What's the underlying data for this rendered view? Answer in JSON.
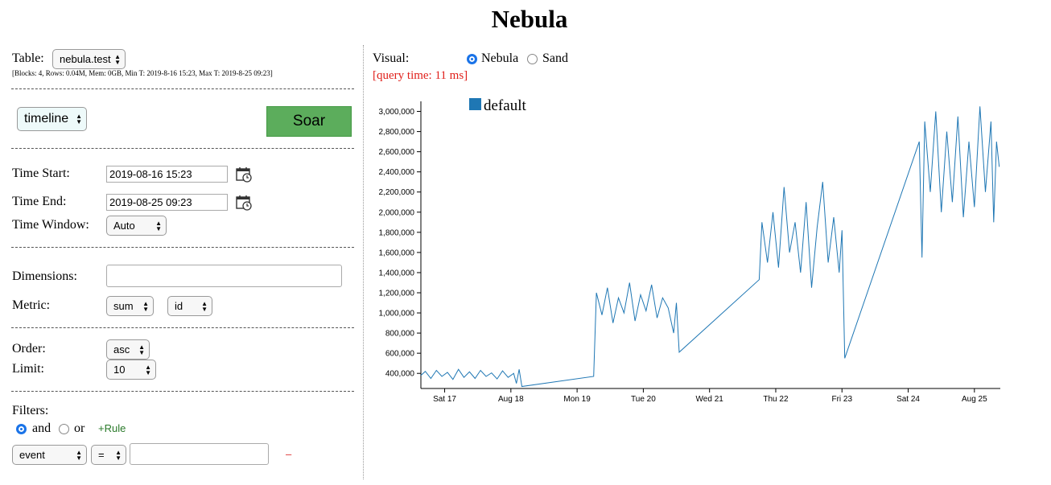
{
  "app": {
    "title": "Nebula"
  },
  "table": {
    "label": "Table:",
    "selected": "nebula.test",
    "meta": "[Blocks: 4, Rows: 0.04M, Mem: 0GB, Min T: 2019-8-16 15:23, Max T: 2019-8-25 09:23]"
  },
  "display": {
    "selected": "timeline",
    "soar_label": "Soar"
  },
  "time": {
    "start_label": "Time Start:",
    "start_value": "2019-08-16 15:23",
    "end_label": "Time End:",
    "end_value": "2019-08-25 09:23",
    "window_label": "Time Window:",
    "window_value": "Auto"
  },
  "dimensions": {
    "label": "Dimensions:",
    "value": ""
  },
  "metric": {
    "label": "Metric:",
    "agg": "sum",
    "field": "id"
  },
  "order": {
    "label": "Order:",
    "value": "asc"
  },
  "limit": {
    "label": "Limit:",
    "value": "10"
  },
  "filters": {
    "label": "Filters:",
    "and_label": "and",
    "or_label": "or",
    "logic_selected": "and",
    "add_rule": "+Rule",
    "rule": {
      "field": "event",
      "op": "=",
      "value": "",
      "remove": "–"
    }
  },
  "visual": {
    "label": "Visual:",
    "options": [
      "Nebula",
      "Sand"
    ],
    "selected": "Nebula",
    "query_time": "[query time: 11 ms]"
  },
  "icons": {
    "calendar": "calendar-clock-icon"
  },
  "colors": {
    "series": "#1f77b4",
    "soar": "#5cad5c",
    "query_time": "#e0201b",
    "add_rule": "#2a7a2a"
  },
  "chart_data": {
    "type": "line",
    "series": [
      {
        "name": "default",
        "points": [
          [
            "2019-08-16 15:23",
            380000
          ],
          [
            "2019-08-16 17:00",
            420000
          ],
          [
            "2019-08-16 19:00",
            350000
          ],
          [
            "2019-08-16 21:00",
            430000
          ],
          [
            "2019-08-16 23:00",
            370000
          ],
          [
            "2019-08-17 01:00",
            410000
          ],
          [
            "2019-08-17 03:00",
            340000
          ],
          [
            "2019-08-17 05:00",
            440000
          ],
          [
            "2019-08-17 07:00",
            360000
          ],
          [
            "2019-08-17 09:00",
            415000
          ],
          [
            "2019-08-17 11:00",
            350000
          ],
          [
            "2019-08-17 13:00",
            430000
          ],
          [
            "2019-08-17 15:00",
            370000
          ],
          [
            "2019-08-17 17:00",
            405000
          ],
          [
            "2019-08-17 19:00",
            345000
          ],
          [
            "2019-08-17 21:00",
            425000
          ],
          [
            "2019-08-17 23:00",
            360000
          ],
          [
            "2019-08-18 01:00",
            400000
          ],
          [
            "2019-08-18 02:00",
            300000
          ],
          [
            "2019-08-18 03:00",
            440000
          ],
          [
            "2019-08-18 04:00",
            270000
          ],
          [
            "2019-08-19 06:00",
            370000
          ],
          [
            "2019-08-19 07:00",
            1200000
          ],
          [
            "2019-08-19 09:00",
            980000
          ],
          [
            "2019-08-19 11:00",
            1250000
          ],
          [
            "2019-08-19 13:00",
            900000
          ],
          [
            "2019-08-19 15:00",
            1150000
          ],
          [
            "2019-08-19 17:00",
            1000000
          ],
          [
            "2019-08-19 19:00",
            1300000
          ],
          [
            "2019-08-19 21:00",
            920000
          ],
          [
            "2019-08-19 23:00",
            1180000
          ],
          [
            "2019-08-20 01:00",
            1020000
          ],
          [
            "2019-08-20 03:00",
            1280000
          ],
          [
            "2019-08-20 05:00",
            950000
          ],
          [
            "2019-08-20 07:00",
            1150000
          ],
          [
            "2019-08-20 09:00",
            1050000
          ],
          [
            "2019-08-20 11:00",
            800000
          ],
          [
            "2019-08-20 12:00",
            1100000
          ],
          [
            "2019-08-20 13:00",
            610000
          ],
          [
            "2019-08-21 18:00",
            1330000
          ],
          [
            "2019-08-21 19:00",
            1900000
          ],
          [
            "2019-08-21 21:00",
            1500000
          ],
          [
            "2019-08-21 23:00",
            2000000
          ],
          [
            "2019-08-22 01:00",
            1450000
          ],
          [
            "2019-08-22 03:00",
            2250000
          ],
          [
            "2019-08-22 05:00",
            1600000
          ],
          [
            "2019-08-22 07:00",
            1900000
          ],
          [
            "2019-08-22 09:00",
            1400000
          ],
          [
            "2019-08-22 11:00",
            2100000
          ],
          [
            "2019-08-22 13:00",
            1250000
          ],
          [
            "2019-08-22 15:00",
            1850000
          ],
          [
            "2019-08-22 17:00",
            2300000
          ],
          [
            "2019-08-22 19:00",
            1500000
          ],
          [
            "2019-08-22 21:00",
            1950000
          ],
          [
            "2019-08-22 23:00",
            1400000
          ],
          [
            "2019-08-23 00:00",
            1820000
          ],
          [
            "2019-08-23 01:00",
            550000
          ],
          [
            "2019-08-24 04:00",
            2700000
          ],
          [
            "2019-08-24 05:00",
            1550000
          ],
          [
            "2019-08-24 06:00",
            2900000
          ],
          [
            "2019-08-24 08:00",
            2200000
          ],
          [
            "2019-08-24 10:00",
            3000000
          ],
          [
            "2019-08-24 12:00",
            2000000
          ],
          [
            "2019-08-24 14:00",
            2800000
          ],
          [
            "2019-08-24 16:00",
            2100000
          ],
          [
            "2019-08-24 18:00",
            2950000
          ],
          [
            "2019-08-24 20:00",
            1950000
          ],
          [
            "2019-08-24 22:00",
            2700000
          ],
          [
            "2019-08-25 00:00",
            2050000
          ],
          [
            "2019-08-25 02:00",
            3050000
          ],
          [
            "2019-08-25 04:00",
            2200000
          ],
          [
            "2019-08-25 06:00",
            2900000
          ],
          [
            "2019-08-25 07:00",
            1900000
          ],
          [
            "2019-08-25 08:00",
            2700000
          ],
          [
            "2019-08-25 09:00",
            2450000
          ]
        ]
      }
    ],
    "ylim": [
      250000,
      3100000
    ],
    "xlim": [
      "2019-08-16 15:23",
      "2019-08-25 09:23"
    ],
    "y_ticks": [
      400000,
      600000,
      800000,
      1000000,
      1200000,
      1400000,
      1600000,
      1800000,
      2000000,
      2200000,
      2400000,
      2600000,
      2800000,
      3000000
    ],
    "y_tick_labels": [
      "400,000",
      "600,000",
      "800,000",
      "1,000,000",
      "1,200,000",
      "1,400,000",
      "1,600,000",
      "1,800,000",
      "2,000,000",
      "2,200,000",
      "2,400,000",
      "2,600,000",
      "2,800,000",
      "3,000,000"
    ],
    "x_ticks": [
      {
        "t": "2019-08-17 00:00",
        "label": "Sat 17"
      },
      {
        "t": "2019-08-18 00:00",
        "label": "Aug 18"
      },
      {
        "t": "2019-08-19 00:00",
        "label": "Mon 19"
      },
      {
        "t": "2019-08-20 00:00",
        "label": "Tue 20"
      },
      {
        "t": "2019-08-21 00:00",
        "label": "Wed 21"
      },
      {
        "t": "2019-08-22 00:00",
        "label": "Thu 22"
      },
      {
        "t": "2019-08-23 00:00",
        "label": "Fri 23"
      },
      {
        "t": "2019-08-24 00:00",
        "label": "Sat 24"
      },
      {
        "t": "2019-08-25 00:00",
        "label": "Aug 25"
      }
    ],
    "legend": {
      "label": "default",
      "position": "top-left"
    },
    "grid": false
  }
}
